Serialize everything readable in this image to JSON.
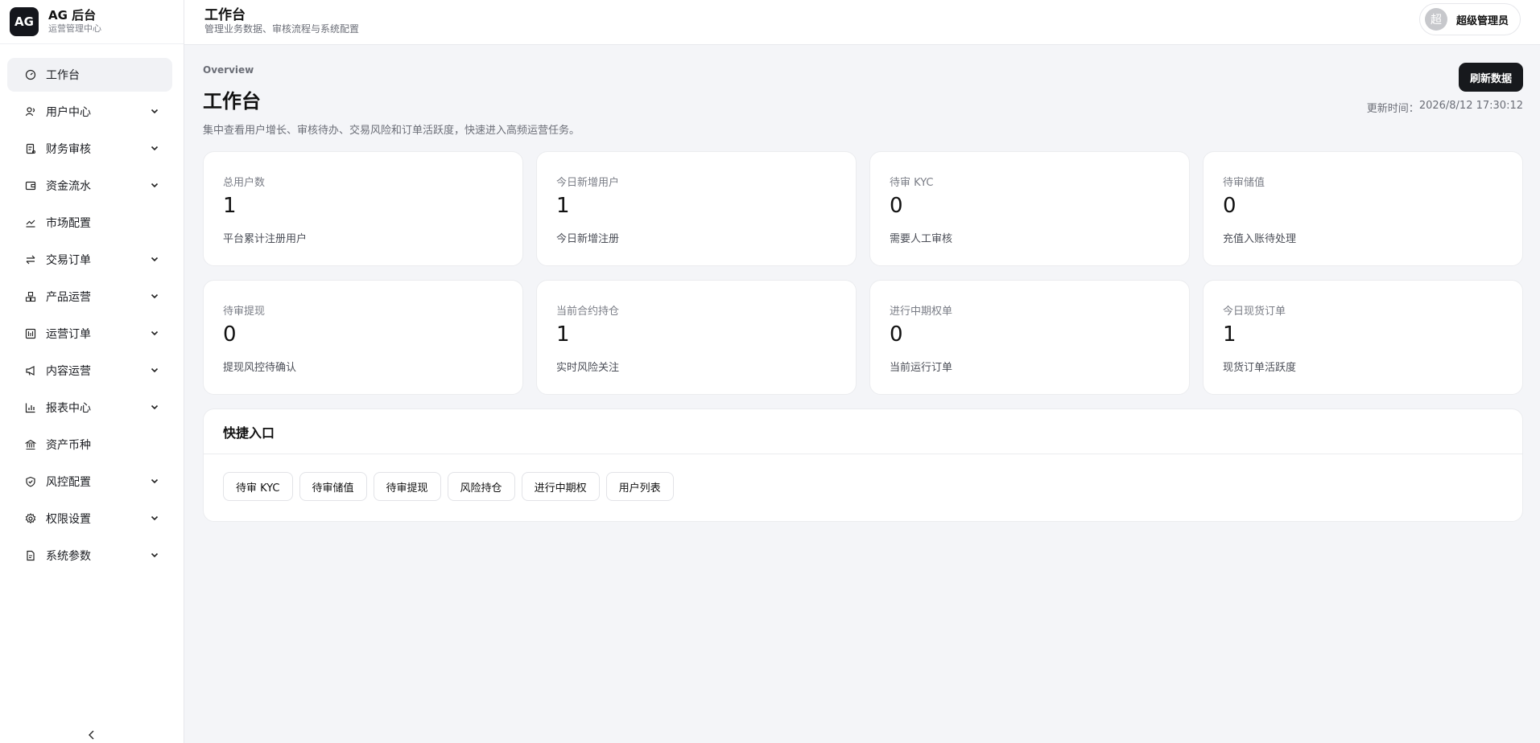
{
  "brand": {
    "logo": "AG",
    "title": "AG 后台",
    "subtitle": "运营管理中心"
  },
  "sidebar": {
    "items": [
      {
        "label": "工作台",
        "icon": "dashboard-icon",
        "active": true,
        "expandable": false
      },
      {
        "label": "用户中心",
        "icon": "users-icon",
        "expandable": true
      },
      {
        "label": "财务审核",
        "icon": "receipt-icon",
        "expandable": true
      },
      {
        "label": "资金流水",
        "icon": "wallet-icon",
        "expandable": true
      },
      {
        "label": "市场配置",
        "icon": "chart-line-icon",
        "expandable": false
      },
      {
        "label": "交易订单",
        "icon": "swap-icon",
        "expandable": true
      },
      {
        "label": "产品运营",
        "icon": "boxes-icon",
        "expandable": true
      },
      {
        "label": "运营订单",
        "icon": "orders-icon",
        "expandable": true
      },
      {
        "label": "内容运营",
        "icon": "megaphone-icon",
        "expandable": true
      },
      {
        "label": "报表中心",
        "icon": "bar-chart-icon",
        "expandable": true
      },
      {
        "label": "资产币种",
        "icon": "bank-icon",
        "expandable": false
      },
      {
        "label": "风控配置",
        "icon": "shield-icon",
        "expandable": true
      },
      {
        "label": "权限设置",
        "icon": "gear-icon",
        "expandable": true
      },
      {
        "label": "系统参数",
        "icon": "file-icon",
        "expandable": true
      }
    ],
    "collapse_icon": "chevron-left-icon"
  },
  "header": {
    "title": "工作台",
    "subtitle": "管理业务数据、审核流程与系统配置",
    "user": {
      "avatar": "超",
      "name": "超级管理员"
    }
  },
  "main": {
    "eyebrow": "Overview",
    "title": "工作台",
    "description": "集中查看用户增长、审核待办、交易风险和订单活跃度，快速进入高频运营任务。",
    "refresh_label": "刷新数据",
    "update_label": "更新时间：",
    "update_time": "2026/8/12 17:30:12",
    "stats": [
      {
        "label": "总用户数",
        "value": "1",
        "note": "平台累计注册用户"
      },
      {
        "label": "今日新增用户",
        "value": "1",
        "note": "今日新增注册"
      },
      {
        "label": "待审 KYC",
        "value": "0",
        "note": "需要人工审核"
      },
      {
        "label": "待审储值",
        "value": "0",
        "note": "充值入账待处理"
      },
      {
        "label": "待审提现",
        "value": "0",
        "note": "提现风控待确认"
      },
      {
        "label": "当前合约持仓",
        "value": "1",
        "note": "实时风险关注"
      },
      {
        "label": "进行中期权单",
        "value": "0",
        "note": "当前运行订单"
      },
      {
        "label": "今日现货订单",
        "value": "1",
        "note": "现货订单活跃度"
      }
    ],
    "quick": {
      "title": "快捷入口",
      "links": [
        "待审 KYC",
        "待审储值",
        "待审提现",
        "风险持仓",
        "进行中期权",
        "用户列表"
      ]
    }
  },
  "colors": {
    "accent": "#17191d",
    "background": "#f4f5f8",
    "active_nav": "#f1f2f5"
  }
}
